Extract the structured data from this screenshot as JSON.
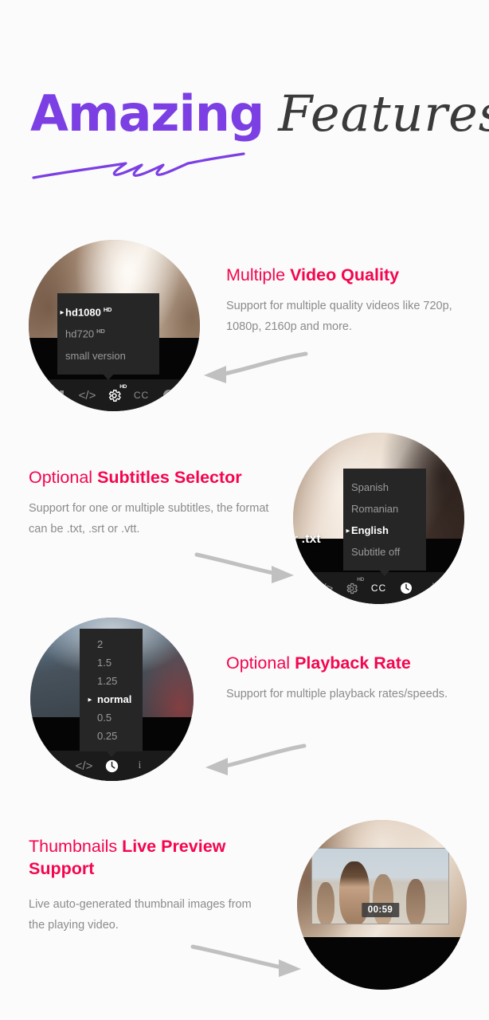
{
  "page": {
    "background_color": "#fbfbfb",
    "accent_purple": "#7b3fe4",
    "accent_crimson": "#f5054f",
    "body_text_color": "#8b8b8b"
  },
  "title": {
    "word_bold": "Amazing",
    "word_italic": "Features",
    "underline_icon": "purple-squiggle-underline"
  },
  "features": [
    {
      "heading_plain": "Multiple ",
      "heading_bold": "Video Quality",
      "body": "Support for multiple quality videos like 720p, 1080p, 2160p and more.",
      "arrow_icon": "curved-arrow-left",
      "player": {
        "menu_title": "quality-menu",
        "menu_items": [
          {
            "label": "hd1080",
            "badge": "HD",
            "selected": true
          },
          {
            "label": "hd720",
            "badge": "HD",
            "selected": false
          },
          {
            "label": "small version",
            "badge": "",
            "selected": false
          }
        ],
        "controls": [
          {
            "icon": "picture-in-picture-icon",
            "glyph": "⌑",
            "active": false
          },
          {
            "icon": "embed-code-icon",
            "glyph": "</>",
            "active": false
          },
          {
            "icon": "settings-gear-hd-icon",
            "glyph": "⚙",
            "active": true,
            "sup": "HD"
          },
          {
            "icon": "closed-captions-icon",
            "glyph": "CC",
            "active": false
          },
          {
            "icon": "playback-rate-clock-icon",
            "glyph": "◔",
            "active": false
          }
        ]
      }
    },
    {
      "heading_plain": "Optional ",
      "heading_bold": "Subtitles Selector",
      "body": "Support for one or multiple subtitles, the format can be .txt, .srt or .vtt.",
      "arrow_icon": "curved-arrow-right",
      "player": {
        "menu_title": "subtitles-menu",
        "subtitle_cue": "r .txt",
        "menu_items": [
          {
            "label": "Spanish",
            "badge": "",
            "selected": false
          },
          {
            "label": "Romanian",
            "badge": "",
            "selected": false
          },
          {
            "label": "English",
            "badge": "",
            "selected": true
          },
          {
            "label": "Subtitle off",
            "badge": "",
            "selected": false
          }
        ],
        "controls": [
          {
            "icon": "embed-code-icon",
            "glyph": "</>",
            "active": false
          },
          {
            "icon": "settings-gear-hd-icon",
            "glyph": "⚙",
            "active": false,
            "sup": "HD"
          },
          {
            "icon": "closed-captions-icon",
            "glyph": "CC",
            "active": true
          },
          {
            "icon": "playback-rate-clock-icon",
            "glyph": "◔",
            "active": true
          },
          {
            "icon": "download-icon",
            "glyph": "⤓",
            "active": false
          }
        ]
      }
    },
    {
      "heading_plain": "Optional ",
      "heading_bold": "Playback Rate",
      "body": "Support for multiple playback rates/speeds.",
      "arrow_icon": "curved-arrow-left",
      "player": {
        "menu_title": "playback-rate-menu",
        "menu_items": [
          {
            "label": "2",
            "badge": "",
            "selected": false
          },
          {
            "label": "1.5",
            "badge": "",
            "selected": false
          },
          {
            "label": "1.25",
            "badge": "",
            "selected": false
          },
          {
            "label": "normal",
            "badge": "",
            "selected": true
          },
          {
            "label": "0.5",
            "badge": "",
            "selected": false
          },
          {
            "label": "0.25",
            "badge": "",
            "selected": false
          }
        ],
        "controls": [
          {
            "icon": "picture-in-picture-icon",
            "glyph": "⌑",
            "active": false
          },
          {
            "icon": "embed-code-icon",
            "glyph": "</>",
            "active": false
          },
          {
            "icon": "playback-rate-clock-icon",
            "glyph": "◔",
            "active": true
          },
          {
            "icon": "info-icon",
            "glyph": "i",
            "active": false
          },
          {
            "icon": "download-icon",
            "glyph": "⤓",
            "active": false
          }
        ]
      }
    },
    {
      "heading_plain": "Thumbnails ",
      "heading_bold": "Live Preview Support",
      "body": "Live auto-generated thumbnail images from the playing video.",
      "arrow_icon": "curved-arrow-right",
      "player": {
        "menu_title": "thumbnail-preview",
        "thumb_time": "00:59"
      }
    }
  ]
}
